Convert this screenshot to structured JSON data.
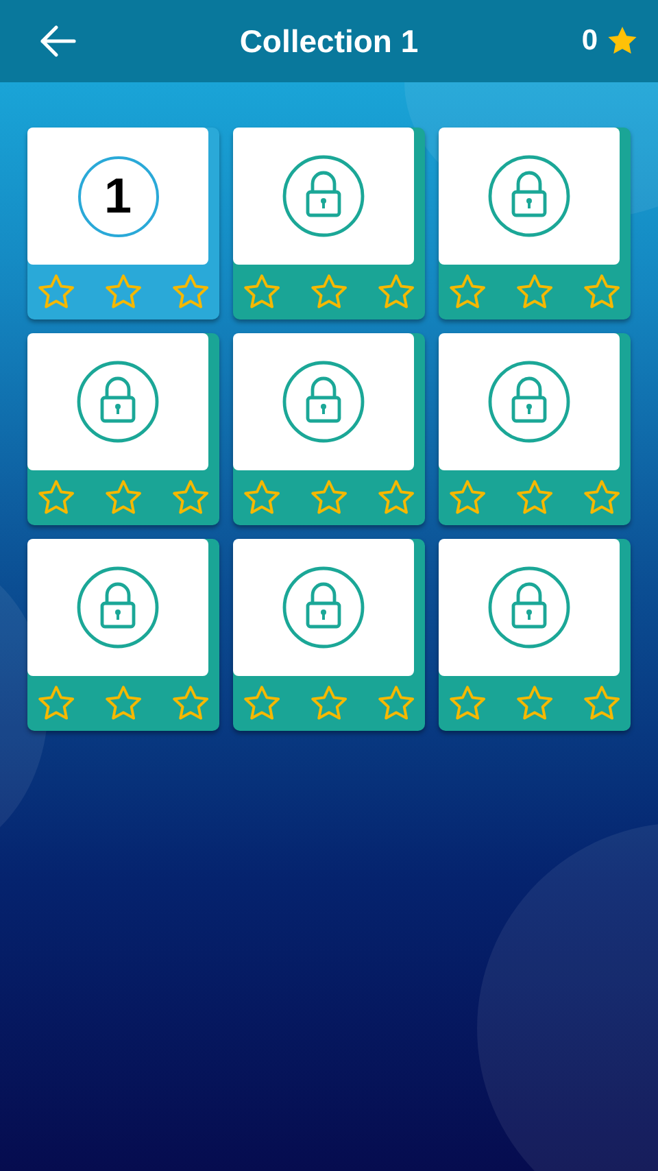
{
  "header": {
    "title": "Collection 1",
    "star_count": "0"
  },
  "levels": [
    {
      "kind": "number",
      "label": "1",
      "stars": 0
    },
    {
      "kind": "locked",
      "stars": 0
    },
    {
      "kind": "locked",
      "stars": 0
    },
    {
      "kind": "locked",
      "stars": 0
    },
    {
      "kind": "locked",
      "stars": 0
    },
    {
      "kind": "locked",
      "stars": 0
    },
    {
      "kind": "locked",
      "stars": 0
    },
    {
      "kind": "locked",
      "stars": 0
    },
    {
      "kind": "locked",
      "stars": 0
    }
  ]
}
